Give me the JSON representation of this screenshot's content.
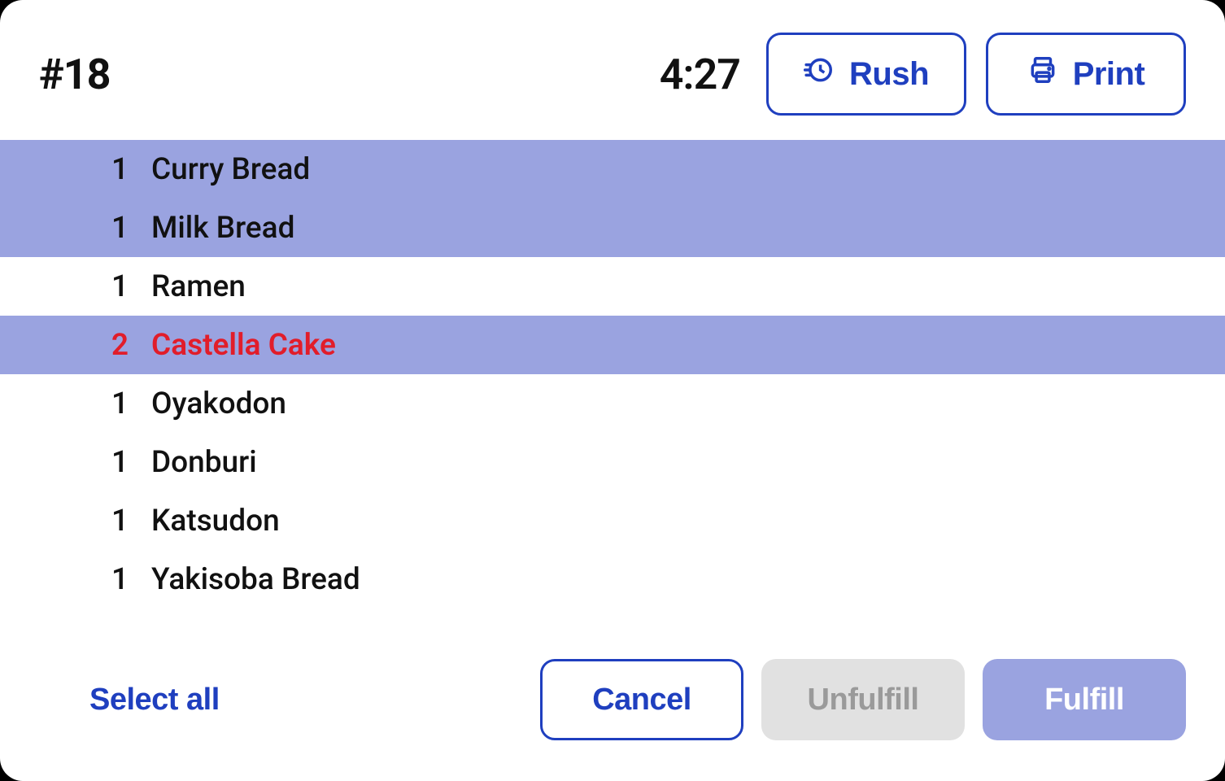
{
  "header": {
    "order_number": "#18",
    "timer": "4:27",
    "rush_label": "Rush",
    "print_label": "Print"
  },
  "items": [
    {
      "qty": "1",
      "name": "Curry Bread",
      "selected": true,
      "alert": false
    },
    {
      "qty": "1",
      "name": "Milk Bread",
      "selected": true,
      "alert": false
    },
    {
      "qty": "1",
      "name": "Ramen",
      "selected": false,
      "alert": false
    },
    {
      "qty": "2",
      "name": "Castella Cake",
      "selected": true,
      "alert": true
    },
    {
      "qty": "1",
      "name": "Oyakodon",
      "selected": false,
      "alert": false
    },
    {
      "qty": "1",
      "name": "Donburi",
      "selected": false,
      "alert": false
    },
    {
      "qty": "1",
      "name": "Katsudon",
      "selected": false,
      "alert": false
    },
    {
      "qty": "1",
      "name": "Yakisoba Bread",
      "selected": false,
      "alert": false
    }
  ],
  "footer": {
    "select_all_label": "Select all",
    "cancel_label": "Cancel",
    "unfulfill_label": "Unfulfill",
    "fulfill_label": "Fulfill"
  },
  "colors": {
    "accent": "#1f3fbf",
    "selected_row": "#9aa3e0",
    "alert_text": "#e11d2a"
  }
}
